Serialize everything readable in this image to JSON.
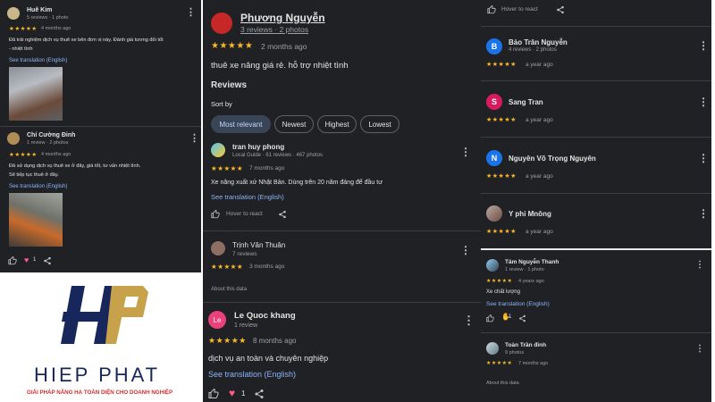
{
  "left_panel": {
    "review1": {
      "name": "Huê Kim",
      "meta": "5 reviews · 1 photo",
      "stars": "★★★★★",
      "time": "4 months ago",
      "text_line1": "Đã trải nghiệm dịch vụ thuê xe bên đơn vị này. Đánh giá tương đối tốt",
      "text_line2": "- nhiệt tình",
      "translate": "See translation (English)"
    },
    "review2": {
      "name": "Chí Cường Đinh",
      "meta": "1 review · 2 photos",
      "stars": "★★★★★",
      "time": "4 months ago",
      "text_line1": "Đã sử dụng dịch vụ thuê xe ở đây, giá tốt, tư vấn nhiệt tình.",
      "text_line2": "Sẽ tiếp tục thuê ở đây.",
      "translate": "See translation (English)",
      "like_count": "1"
    }
  },
  "middle_panel": {
    "top_review": {
      "name": "Phương Nguyễn",
      "meta": "3 reviews · 2 photos",
      "stars": "★★★★★",
      "time": "2 months ago",
      "text": "thuê xe nâng giá rẻ. hỗ trợ nhiệt tình"
    },
    "reviews_heading": "Reviews",
    "sort_by_label": "Sort by",
    "sort_options": [
      "Most relevant",
      "Newest",
      "Highest",
      "Lowest"
    ],
    "review_tran": {
      "name": "tran huy phong",
      "meta": "Local Guide · 61 reviews · 467 photos",
      "stars": "★★★★★",
      "time": "7 months ago",
      "text": "Xe nâng xuất xứ Nhật Bản. Dùng trên 20 năm đáng để đầu tư",
      "translate": "See translation (English)",
      "hover_text": "Hover to react"
    },
    "review_trinh": {
      "name": "Trịnh Văn Thuân",
      "meta": "7 reviews",
      "stars": "★★★★★",
      "time": "3 months ago"
    },
    "about_data": "About this data",
    "review_le": {
      "avatar_letter": "Le",
      "name": "Le Quoc khang",
      "meta": "1 review",
      "stars": "★★★★★",
      "time": "8 months ago",
      "text": "dịch vụ an toàn và chuyên nghiệp",
      "translate": "See translation (English)",
      "like_count": "1"
    }
  },
  "right_panel": {
    "hover_text": "Hover to react",
    "reviews": [
      {
        "avatar_letter": "B",
        "avatar_color": "#1a73e8",
        "name": "Bảo Trân Nguyễn",
        "meta": "4 reviews · 2 photos",
        "stars": "★★★★★",
        "time": "a year ago"
      },
      {
        "avatar_letter": "S",
        "avatar_color": "#d81b60",
        "name": "Sang Tran",
        "meta": "",
        "stars": "★★★★★",
        "time": "a year ago"
      },
      {
        "avatar_letter": "N",
        "avatar_color": "#1a73e8",
        "name": "Nguyên Võ Trọng Nguyên",
        "meta": "",
        "stars": "★★★★★",
        "time": "a year ago"
      },
      {
        "avatar_letter": "",
        "avatar_color": "#9e8b84",
        "name": "Y phi Mnông",
        "meta": "",
        "stars": "★★★★★",
        "time": "a year ago"
      }
    ],
    "review_tam": {
      "name": "Tâm Nguyễn Thanh",
      "meta": "1 review · 1 photo",
      "stars": "★★★★★",
      "time": "4 years ago",
      "text": "Xe chất lượng",
      "translate": "See translation (English)",
      "like_count": "1"
    },
    "review_toan": {
      "name": "Toàn Trần đinh",
      "meta": "9 photos",
      "stars": "★★★★★",
      "time": "7 months ago"
    },
    "about_data": "About this data"
  },
  "logo": {
    "letters": "HP",
    "name": "HIEP PHAT",
    "tagline": "GIẢI PHÁP NÂNG HẠ TOÀN DIỆN CHO DOANH NGHIỆP",
    "colors": {
      "navy": "#17275c",
      "gold": "#c8a24a",
      "red": "#d32f2f"
    }
  },
  "colors": {
    "panel_bg": "#202124",
    "star": "#f9b826",
    "link": "#8ab4f8",
    "heart": "#ff5a8a"
  }
}
